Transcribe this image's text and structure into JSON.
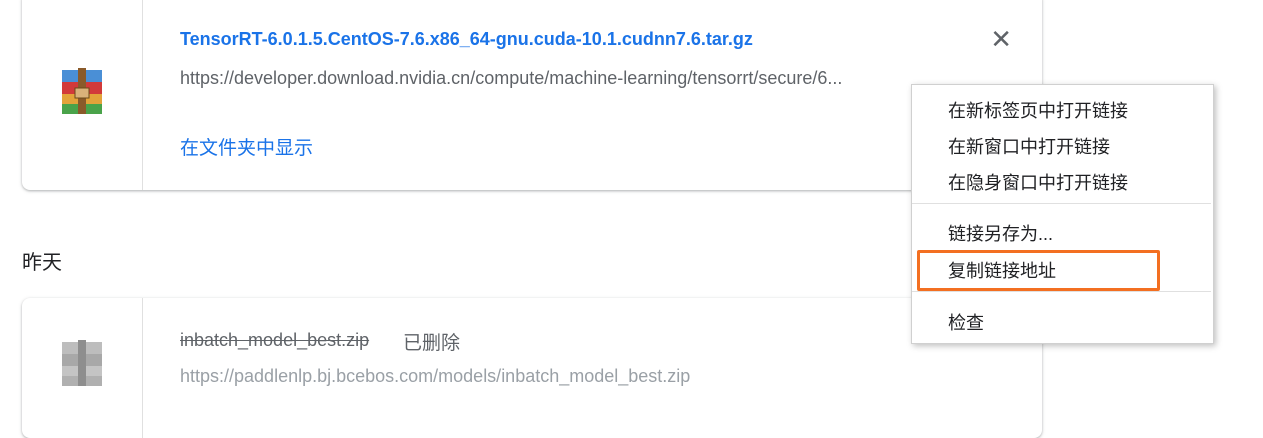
{
  "downloads": [
    {
      "file_name": "TensorRT-6.0.1.5.CentOS-7.6.x86_64-gnu.cuda-10.1.cudnn7.6.tar.gz",
      "url": "https://developer.download.nvidia.cn/compute/machine-learning/tensorrt/secure/6...",
      "action_label": "在文件夹中显示",
      "close_symbol": "✕",
      "icon": "archive-icon"
    }
  ],
  "sections": {
    "yesterday_label": "昨天"
  },
  "deleted_download": {
    "file_name": "inbatch_model_best.zip",
    "status": "已删除",
    "url": "https://paddlenlp.bj.bcebos.com/models/inbatch_model_best.zip",
    "icon": "archive-icon"
  },
  "context_menu": {
    "items": [
      "在新标签页中打开链接",
      "在新窗口中打开链接",
      "在隐身窗口中打开链接",
      "链接另存为...",
      "复制链接地址",
      "检查"
    ],
    "highlighted_index": 4,
    "highlight_color": "#f36f21"
  },
  "colors": {
    "link_blue": "#1a73e8",
    "text_gray": "#5f6368"
  }
}
